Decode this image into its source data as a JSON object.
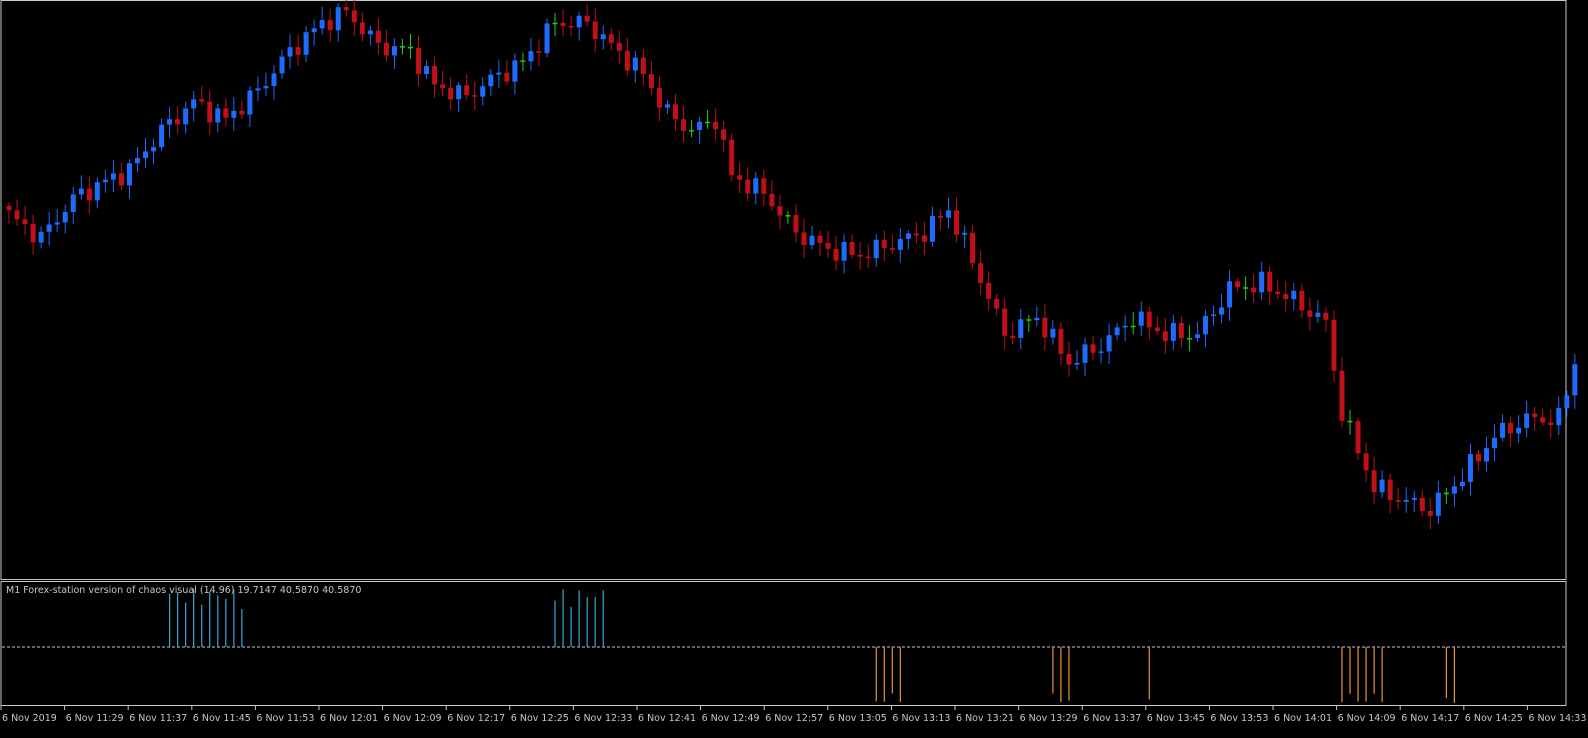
{
  "chart_data": {
    "type": "candlestick",
    "background": "#000000",
    "colors": {
      "bull": "#1f6bff",
      "bear": "#c0101a",
      "doji": "#19d219",
      "frame": "#c8c8c8",
      "histogram_up": "#3aa6d6",
      "histogram_down": "#e69633",
      "zero_line": "#c8c8c8"
    },
    "price_range": [
      0,
      1
    ],
    "time_labels": [
      "6 Nov 2019",
      "6 Nov 11:29",
      "6 Nov 11:37",
      "6 Nov 11:45",
      "6 Nov 11:53",
      "6 Nov 12:01",
      "6 Nov 12:09",
      "6 Nov 12:17",
      "6 Nov 12:25",
      "6 Nov 12:33",
      "6 Nov 12:41",
      "6 Nov 12:49",
      "6 Nov 12:57",
      "6 Nov 13:05",
      "6 Nov 13:13",
      "6 Nov 13:21",
      "6 Nov 13:29",
      "6 Nov 13:37",
      "6 Nov 13:45",
      "6 Nov 13:53",
      "6 Nov 14:01",
      "6 Nov 14:09",
      "6 Nov 14:17",
      "6 Nov 14:25",
      "6 Nov 14:33"
    ],
    "anchors": [
      [
        0,
        0.63
      ],
      [
        4,
        0.59
      ],
      [
        8,
        0.66
      ],
      [
        12,
        0.69
      ],
      [
        15,
        0.71
      ],
      [
        19,
        0.78
      ],
      [
        23,
        0.83
      ],
      [
        27,
        0.8
      ],
      [
        31,
        0.85
      ],
      [
        35,
        0.92
      ],
      [
        39,
        0.97
      ],
      [
        42,
        0.99
      ],
      [
        46,
        0.93
      ],
      [
        50,
        0.92
      ],
      [
        53,
        0.86
      ],
      [
        57,
        0.84
      ],
      [
        60,
        0.87
      ],
      [
        64,
        0.9
      ],
      [
        68,
        0.97
      ],
      [
        72,
        0.97
      ],
      [
        75,
        0.93
      ],
      [
        79,
        0.88
      ],
      [
        82,
        0.81
      ],
      [
        85,
        0.78
      ],
      [
        88,
        0.8
      ],
      [
        90,
        0.7
      ],
      [
        94,
        0.67
      ],
      [
        98,
        0.6
      ],
      [
        102,
        0.57
      ],
      [
        106,
        0.56
      ],
      [
        110,
        0.58
      ],
      [
        114,
        0.6
      ],
      [
        117,
        0.64
      ],
      [
        120,
        0.55
      ],
      [
        124,
        0.42
      ],
      [
        128,
        0.45
      ],
      [
        132,
        0.37
      ],
      [
        136,
        0.4
      ],
      [
        140,
        0.45
      ],
      [
        144,
        0.42
      ],
      [
        148,
        0.42
      ],
      [
        152,
        0.5
      ],
      [
        156,
        0.51
      ],
      [
        160,
        0.48
      ],
      [
        164,
        0.44
      ],
      [
        166,
        0.28
      ],
      [
        170,
        0.15
      ],
      [
        173,
        0.13
      ],
      [
        177,
        0.11
      ],
      [
        181,
        0.17
      ],
      [
        185,
        0.24
      ],
      [
        189,
        0.27
      ],
      [
        193,
        0.27
      ],
      [
        195,
        0.37
      ]
    ],
    "indicator": {
      "label": "M1 Forex-station version of chaos visual (14.96) 19.7147 40.5870 40.5870",
      "up_groups": [
        [
          20,
          29
        ],
        [
          68,
          74
        ]
      ],
      "down_groups": [
        [
          108,
          111
        ],
        [
          130,
          132
        ],
        [
          142,
          142
        ],
        [
          166,
          171
        ],
        [
          179,
          180
        ]
      ]
    }
  }
}
